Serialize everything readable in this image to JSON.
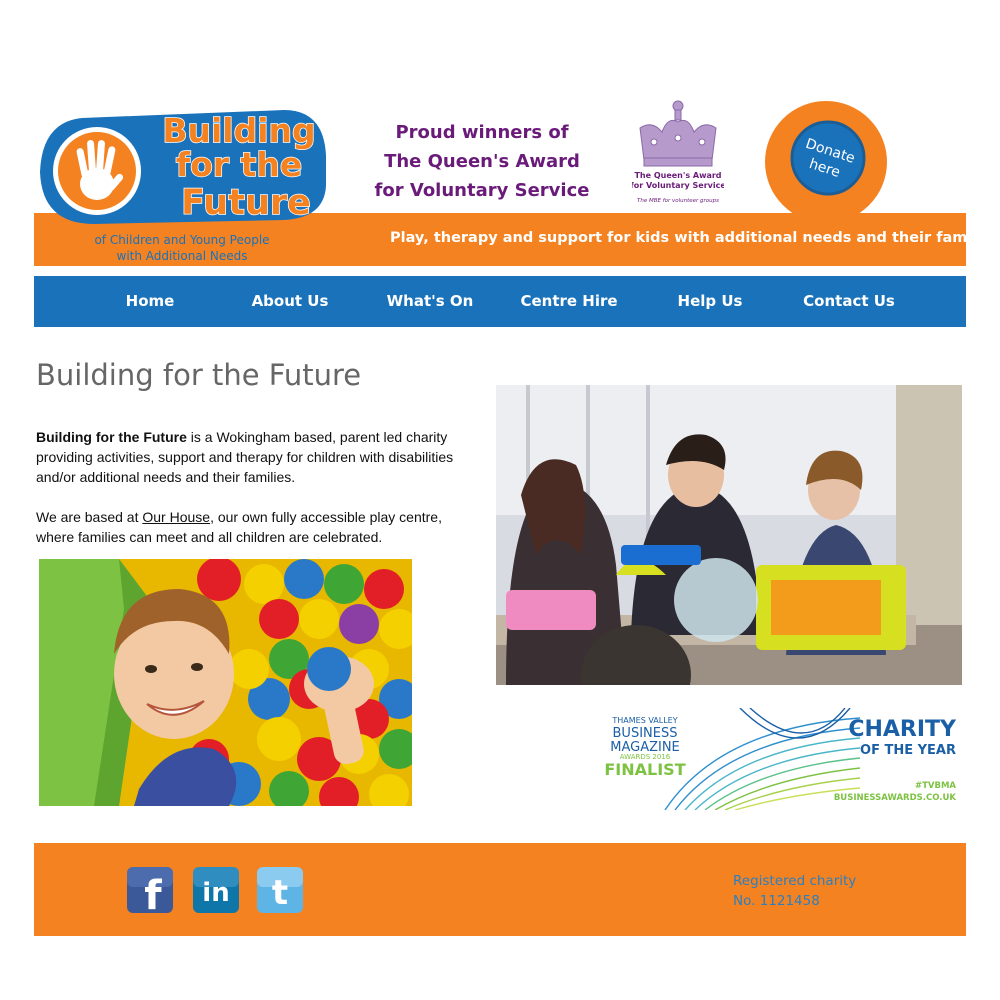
{
  "header": {
    "logo": {
      "line1": "Building",
      "line2": "for the",
      "line3": "Future",
      "sub1": "of Children and Young People",
      "sub2": "with Additional Needs"
    },
    "tagline": "Play, therapy and support for kids with additional needs and their families",
    "award": {
      "line1": "Proud winners of",
      "line2": "The Queen's Award",
      "line3": "for Voluntary Service",
      "badge_line1": "The Queen's Award",
      "badge_line2": "for Voluntary Service",
      "badge_line3": "The MBE for volunteer groups"
    },
    "donate": {
      "line1": "Donate",
      "line2": "here"
    }
  },
  "nav": {
    "items": [
      {
        "label": "Home"
      },
      {
        "label": "About Us"
      },
      {
        "label": "What's On"
      },
      {
        "label": "Centre Hire"
      },
      {
        "label": "Help Us"
      },
      {
        "label": "Contact Us"
      }
    ]
  },
  "main": {
    "title": "Building for the Future",
    "intro_bold": "Building for the Future",
    "intro_rest": " is a Wokingham based, parent led charity providing activities, support and therapy for children with disabilities and/or additional needs and their families.",
    "para2_start": "We are based at ",
    "para2_link": "Our House",
    "para2_end": ", our own fully accessible play centre, where families can meet and all children are celebrated."
  },
  "banner": {
    "org1": "THAMES VALLEY",
    "org2": "BUSINESS",
    "org3": "MAGAZINE",
    "year": "AWARDS 2016",
    "status": "FINALIST",
    "title1": "CHARITY",
    "title2": "OF THE YEAR",
    "hashtag": "#TVBMA",
    "site": "BUSINESSAWARDS.CO.UK"
  },
  "footer": {
    "social": [
      {
        "name": "facebook-icon",
        "glyph": "f"
      },
      {
        "name": "linkedin-icon",
        "glyph": "in"
      },
      {
        "name": "twitter-icon",
        "glyph": "t"
      }
    ],
    "reg_line1": "Registered charity",
    "reg_line2": "No. 1121458"
  },
  "colors": {
    "orange": "#f58220",
    "blue": "#1a72bb",
    "purple": "#6a1b7a",
    "green": "#7dc243"
  }
}
